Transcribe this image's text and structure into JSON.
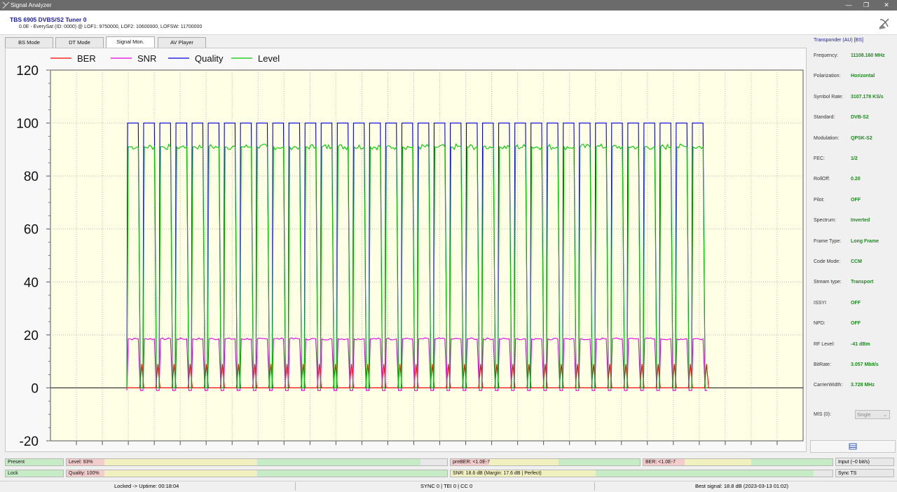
{
  "window": {
    "title": "Signal Analyzer",
    "controls": {
      "minimize": "—",
      "restore": "❐",
      "close": "✕"
    }
  },
  "header": {
    "device": "TBS 6905 DVBS/S2 Tuner 0",
    "subtitle": "0.0E - EverySat (ID: 0000) @ LOF1: 9750000, LOF2: 10600000, LOFSW: 11700000"
  },
  "tabs": [
    {
      "label": "BS Mode",
      "active": false
    },
    {
      "label": "DT Mode",
      "active": false
    },
    {
      "label": "Signal Mon.",
      "active": true
    },
    {
      "label": "AV Player",
      "active": false
    }
  ],
  "chart_data": {
    "type": "line",
    "xlabel": "",
    "ylabel": "",
    "ylim": [
      -20,
      120
    ],
    "yticks": [
      -20,
      0,
      20,
      40,
      60,
      80,
      100,
      120
    ],
    "grid": true,
    "legend_position": "top-left",
    "series": [
      {
        "name": "BER",
        "color": "#ff0000",
        "on_value": 0,
        "spike_value": 9
      },
      {
        "name": "SNR",
        "color": "#e000e0",
        "on_value": 18.5,
        "off_value": -1
      },
      {
        "name": "Quality",
        "color": "#0000e0",
        "on_value": 100,
        "off_value": 0
      },
      {
        "name": "Level",
        "color": "#00c800",
        "on_value": 91,
        "off_value": 0
      }
    ],
    "signal_segments": 36
  },
  "colors": {
    "plot_bg": "#ffffe6",
    "bar_green": "#c6ecc6",
    "bar_yellow": "#f1f1bf",
    "bar_pink": "#f4cccc",
    "value_green": "#1e8a1e",
    "accent_blue": "#1a1aa8"
  },
  "transponder": {
    "title": "Transponder (AU) [BS]",
    "fields": [
      {
        "key": "Frequency:",
        "value": "11108.160 MHz"
      },
      {
        "key": "Polarization:",
        "value": "Horizontal"
      },
      {
        "key": "Symbol Rate:",
        "value": "3107.178 KS/s"
      },
      {
        "key": "Standard:",
        "value": "DVB-S2"
      },
      {
        "key": "Modulation:",
        "value": "QPSK-S2"
      },
      {
        "key": "FEC:",
        "value": "1/2"
      },
      {
        "key": "RollOff:",
        "value": "0.20"
      },
      {
        "key": "Pilot:",
        "value": "OFF"
      },
      {
        "key": "Spectrum:",
        "value": "Inverted"
      },
      {
        "key": "Frame Type:",
        "value": "Long Frame"
      },
      {
        "key": "Code Mode:",
        "value": "CCM"
      },
      {
        "key": "Stream type:",
        "value": "Transport"
      },
      {
        "key": "ISSYI",
        "value": "OFF"
      },
      {
        "key": "NPD:",
        "value": "OFF"
      },
      {
        "key": "RF Level:",
        "value": "-41 dBm"
      },
      {
        "key": "BitRate:",
        "value": "3.057 Mbit/s"
      },
      {
        "key": "CarrierWidth:",
        "value": "3.728 MHz"
      }
    ],
    "mis_label": "MIS (0):",
    "mis_value": "Single"
  },
  "indicators": {
    "present": "Present",
    "level": "Level: 93%",
    "preber": "preBER: <1.0E-7",
    "ber": "BER: <1.0E-7",
    "input": "Input (~0 bit/s)",
    "lock": "Lock",
    "quality": "Quality: 100%",
    "snr": "SNR: 18.6 dB (Margin: 17.6 dB | Perfect)",
    "sync_ts": "Sync TS"
  },
  "status": {
    "uptime": "Locked -> Uptime: 00:18:04",
    "sync": "SYNC 0 | TEI 0 | CC 0",
    "best": "Best signal: 18.8 dB (2023-03-13 01:02)"
  }
}
